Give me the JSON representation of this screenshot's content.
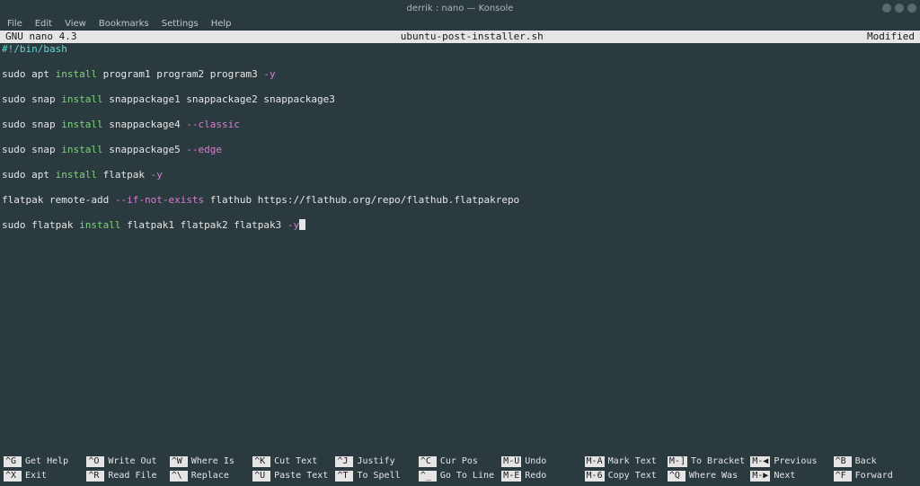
{
  "window": {
    "title": "derrik : nano — Konsole"
  },
  "menu": {
    "items": [
      "File",
      "Edit",
      "View",
      "Bookmarks",
      "Settings",
      "Help"
    ]
  },
  "nano": {
    "app": "GNU nano 4.3",
    "filename": "ubuntu-post-installer.sh",
    "status": "Modified",
    "lines": [
      [
        {
          "c": "cyan",
          "t": "#!/bin/bash"
        }
      ],
      [],
      [
        {
          "c": "white",
          "t": "sudo apt "
        },
        {
          "c": "green",
          "t": "install"
        },
        {
          "c": "white",
          "t": " program1 program2 program3 "
        },
        {
          "c": "pink",
          "t": "-y"
        }
      ],
      [],
      [
        {
          "c": "white",
          "t": "sudo snap "
        },
        {
          "c": "green",
          "t": "install"
        },
        {
          "c": "white",
          "t": " snappackage1 snappackage2 snappackage3"
        }
      ],
      [],
      [
        {
          "c": "white",
          "t": "sudo snap "
        },
        {
          "c": "green",
          "t": "install"
        },
        {
          "c": "white",
          "t": " snappackage4 "
        },
        {
          "c": "pink",
          "t": "--classic"
        }
      ],
      [],
      [
        {
          "c": "white",
          "t": "sudo snap "
        },
        {
          "c": "green",
          "t": "install"
        },
        {
          "c": "white",
          "t": " snappackage5 "
        },
        {
          "c": "pink",
          "t": "--edge"
        }
      ],
      [],
      [
        {
          "c": "white",
          "t": "sudo apt "
        },
        {
          "c": "green",
          "t": "install"
        },
        {
          "c": "white",
          "t": " flatpak "
        },
        {
          "c": "pink",
          "t": "-y"
        }
      ],
      [],
      [
        {
          "c": "white",
          "t": "flatpak remote-add "
        },
        {
          "c": "pink",
          "t": "--if-not-exists"
        },
        {
          "c": "white",
          "t": " flathub https://flathub.org/repo/flathub.flatpakrepo"
        }
      ],
      [],
      [
        {
          "c": "white",
          "t": "sudo flatpak "
        },
        {
          "c": "green",
          "t": "install"
        },
        {
          "c": "white",
          "t": " flatpak1 flatpak2 flatpak3 "
        },
        {
          "c": "pink",
          "t": "-y"
        },
        {
          "cursor": true
        }
      ]
    ],
    "shortcuts_row1": [
      {
        "key": "^G",
        "label": "Get Help"
      },
      {
        "key": "^O",
        "label": "Write Out"
      },
      {
        "key": "^W",
        "label": "Where Is"
      },
      {
        "key": "^K",
        "label": "Cut Text"
      },
      {
        "key": "^J",
        "label": "Justify"
      },
      {
        "key": "^C",
        "label": "Cur Pos"
      },
      {
        "key": "M-U",
        "label": "Undo"
      },
      {
        "key": "M-A",
        "label": "Mark Text"
      },
      {
        "key": "M-]",
        "label": "To Bracket"
      },
      {
        "key": "M-◀",
        "label": "Previous"
      }
    ],
    "shortcuts_row2": [
      {
        "key": "^X",
        "label": "Exit"
      },
      {
        "key": "^R",
        "label": "Read File"
      },
      {
        "key": "^\\",
        "label": "Replace"
      },
      {
        "key": "^U",
        "label": "Paste Text"
      },
      {
        "key": "^T",
        "label": "To Spell"
      },
      {
        "key": "^_",
        "label": "Go To Line"
      },
      {
        "key": "M-E",
        "label": "Redo"
      },
      {
        "key": "M-6",
        "label": "Copy Text"
      },
      {
        "key": "^Q",
        "label": "Where Was"
      },
      {
        "key": "M-▶",
        "label": "Next"
      }
    ],
    "shortcuts_extra": [
      {
        "key": "^B",
        "label": "Back"
      },
      {
        "key": "^F",
        "label": "Forward"
      }
    ]
  }
}
